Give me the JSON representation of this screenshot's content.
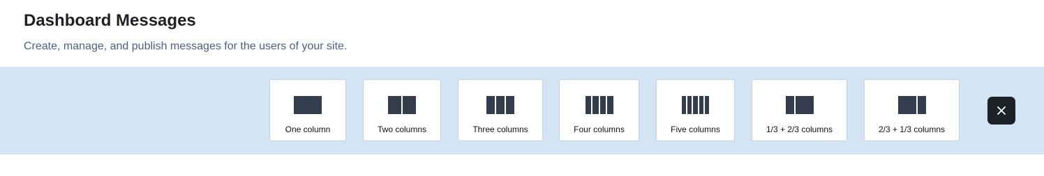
{
  "header": {
    "title": "Dashboard Messages",
    "subtitle": "Create, manage, and publish messages for the users of your site."
  },
  "layout_options": [
    {
      "label": "One column",
      "icon": "one-column-layout-icon"
    },
    {
      "label": "Two columns",
      "icon": "two-columns-layout-icon"
    },
    {
      "label": "Three columns",
      "icon": "three-columns-layout-icon"
    },
    {
      "label": "Four columns",
      "icon": "four-columns-layout-icon"
    },
    {
      "label": "Five columns",
      "icon": "five-columns-layout-icon"
    },
    {
      "label": "1/3 + 2/3 columns",
      "icon": "one-third-two-thirds-layout-icon"
    },
    {
      "label": "2/3 + 1/3 columns",
      "icon": "two-thirds-one-third-layout-icon"
    }
  ],
  "close_button": {
    "icon": "close-icon"
  },
  "colors": {
    "bar_background": "#d3e4f4",
    "column_fill": "#343d4e",
    "close_button_background": "#1e2227",
    "subtitle": "#4a6287"
  }
}
